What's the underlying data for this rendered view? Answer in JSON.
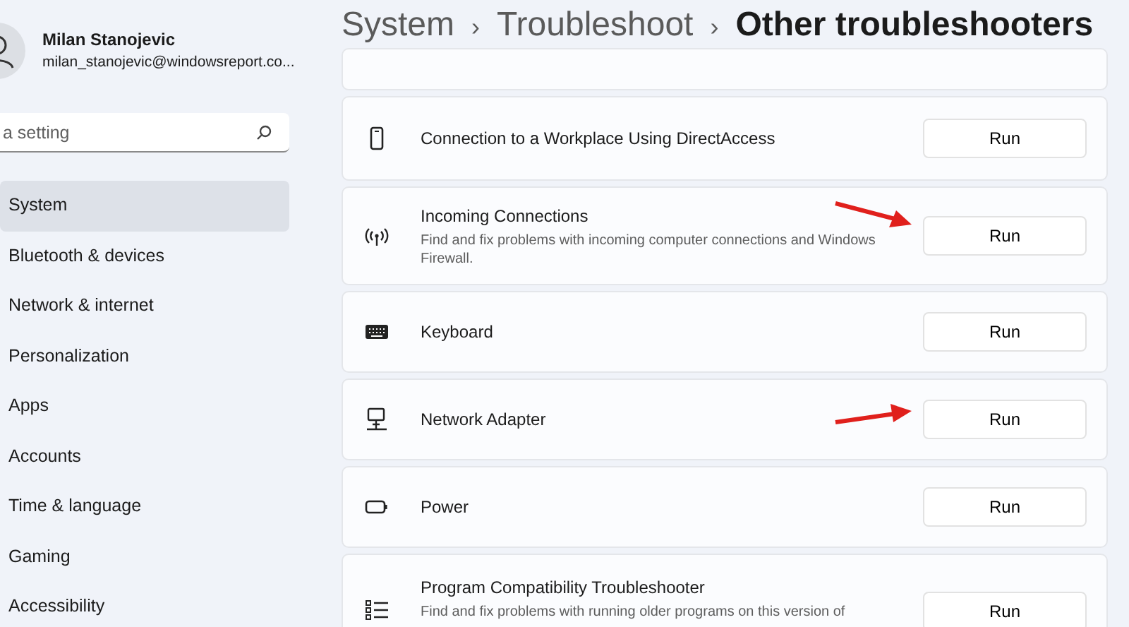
{
  "account": {
    "name": "Milan Stanojevic",
    "email": "milan_stanojevic@windowsreport.co..."
  },
  "search": {
    "placeholder": "a setting"
  },
  "sidebar": {
    "items": [
      {
        "label": "System",
        "selected": true
      },
      {
        "label": "Bluetooth & devices",
        "selected": false
      },
      {
        "label": "Network & internet",
        "selected": false
      },
      {
        "label": "Personalization",
        "selected": false
      },
      {
        "label": "Apps",
        "selected": false
      },
      {
        "label": "Accounts",
        "selected": false
      },
      {
        "label": "Time & language",
        "selected": false
      },
      {
        "label": "Gaming",
        "selected": false
      },
      {
        "label": "Accessibility",
        "selected": false
      }
    ]
  },
  "breadcrumb": [
    {
      "label": "System"
    },
    {
      "label": "›"
    },
    {
      "label": "Troubleshoot"
    },
    {
      "label": "›"
    },
    {
      "label": "Other troubleshooters"
    }
  ],
  "troubleshooters": [
    {
      "kind": "phone",
      "title": "Connection to a Workplace Using DirectAccess",
      "button": "Run",
      "arrow": false
    },
    {
      "kind": "antenna",
      "title": "Incoming Connections",
      "description": "Find and fix problems with incoming computer connections and Windows Firewall.",
      "button": "Run",
      "arrow": true
    },
    {
      "kind": "keyboard",
      "title": "Keyboard",
      "button": "Run",
      "arrow": false
    },
    {
      "kind": "network",
      "title": "Network Adapter",
      "button": "Run",
      "arrow": true
    },
    {
      "kind": "battery",
      "title": "Power",
      "button": "Run",
      "arrow": false
    },
    {
      "kind": "list",
      "title": "Program Compatibility Troubleshooter",
      "description": "Find and fix problems with running older programs on this version of",
      "button": "Run",
      "arrow": false
    }
  ]
}
